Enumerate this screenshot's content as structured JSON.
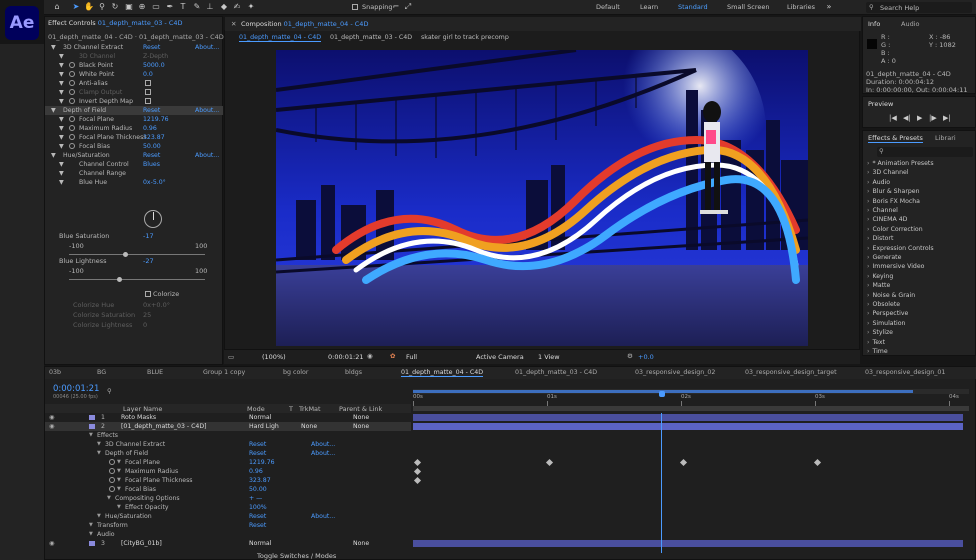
{
  "app": {
    "logo": "Ae"
  },
  "toolbar": {
    "snapping": "Snapping",
    "workspaces": [
      "Default",
      "Learn",
      "Standard",
      "Small Screen",
      "Libraries"
    ],
    "active_workspace": "Standard",
    "search": "Search Help"
  },
  "effect_controls": {
    "tab": "Effect Controls",
    "tab_layer": "01_depth_matte_03 - C4D",
    "breadcrumb": "01_depth_matte_04 - C4D · 01_depth_matte_03 - C4D",
    "rows": [
      {
        "label": "3D Channel Extract",
        "reset": "Reset",
        "about": "About..."
      },
      {
        "label": "3D Channel",
        "value": "Z-Depth",
        "dim": true
      },
      {
        "label": "Black Point",
        "value": "5000.0"
      },
      {
        "label": "White Point",
        "value": "0.0"
      },
      {
        "label": "Anti-alias",
        "check": true
      },
      {
        "label": "Clamp Output",
        "check": true,
        "dim": true
      },
      {
        "label": "Invert Depth Map",
        "check": true
      },
      {
        "label": "Depth of Field",
        "reset": "Reset",
        "about": "About..."
      },
      {
        "label": "Focal Plane",
        "value": "1219.76"
      },
      {
        "label": "Maximum Radius",
        "value": "0.96"
      },
      {
        "label": "Focal Plane Thickness",
        "value": "323.87"
      },
      {
        "label": "Focal Bias",
        "value": "50.00"
      },
      {
        "label": "Hue/Saturation",
        "reset": "Reset",
        "about": "About..."
      },
      {
        "label": "Channel Control",
        "value": "Blues"
      },
      {
        "label": "Channel Range"
      },
      {
        "label": "Blue Hue",
        "value": "0x-5.0°"
      }
    ],
    "blue_saturation": {
      "label": "Blue Saturation",
      "value": "-17",
      "min": "-100",
      "max": "100"
    },
    "blue_lightness": {
      "label": "Blue Lightness",
      "value": "-27",
      "min": "-100",
      "max": "100"
    },
    "colorize": "Colorize",
    "dim_rows": [
      {
        "label": "Colorize Hue",
        "value": "0x+0.0°"
      },
      {
        "label": "Colorize Saturation",
        "value": "25"
      },
      {
        "label": "Colorize Lightness",
        "value": "0"
      }
    ]
  },
  "composition": {
    "panel_tab": "Composition",
    "panel_comp": "01_depth_matte_04 - C4D",
    "tabs": [
      "01_depth_matte_04 - C4D",
      "01_depth_matte_03 - C4D",
      "skater girl to track precomp"
    ],
    "bottom": {
      "zoom": "(100%)",
      "time": "0:00:01:21",
      "res": "Full",
      "camera": "Active Camera",
      "views": "1 View",
      "exposure": "+0.0"
    }
  },
  "info": {
    "tabs": [
      "Info",
      "Audio"
    ],
    "rgb": [
      "R :",
      "G :",
      "B :",
      "A : 0"
    ],
    "xy": [
      "X : -86",
      "Y : 1082"
    ],
    "comp": "01_depth_matte_04 - C4D",
    "duration": "Duration: 0:00:04:12",
    "inout": "In: 0:00:00:00, Out: 0:00:04:11"
  },
  "preview": {
    "title": "Preview"
  },
  "effects_presets": {
    "tabs": [
      "Effects & Presets",
      "Librari"
    ],
    "items": [
      "* Animation Presets",
      "3D Channel",
      "Audio",
      "Blur & Sharpen",
      "Boris FX Mocha",
      "Channel",
      "CINEMA 4D",
      "Color Correction",
      "Distort",
      "Expression Controls",
      "Generate",
      "Immersive Video",
      "Keying",
      "Matte",
      "Noise & Grain",
      "Obsolete",
      "Perspective",
      "Simulation",
      "Stylize",
      "Text",
      "Time"
    ]
  },
  "timeline": {
    "tabs": [
      "03b",
      "BG",
      "BLUE",
      "Group 1 copy",
      "bg color",
      "bldgs",
      "01_depth_matte_04 - C4D",
      "01_depth_matte_03 - C4D",
      "03_responsive_design_02",
      "03_responsive_design_target",
      "03_responsive_design_01"
    ],
    "time": "0:00:01:21",
    "fps": "00046 (25.00 fps)",
    "cols": {
      "layer": "Layer Name",
      "mode": "Mode",
      "t": "T",
      "trkmat": "TrkMat",
      "parent": "Parent & Link"
    },
    "ruler": [
      "00s",
      "01s",
      "02s",
      "03s",
      "04s"
    ],
    "layers": [
      {
        "num": "1",
        "name": "Roto Masks",
        "mode": "Normal",
        "parent": "None"
      },
      {
        "num": "2",
        "name": "[01_depth_matte_03 - C4D]",
        "mode": "Hard Ligh",
        "trk": "None",
        "parent": "None"
      }
    ],
    "props": [
      {
        "label": "Effects"
      },
      {
        "label": "3D Channel Extract",
        "reset": "Reset",
        "about": "About..."
      },
      {
        "label": "Depth of Field",
        "reset": "Reset",
        "about": "About..."
      },
      {
        "label": "Focal Plane",
        "value": "1219.76"
      },
      {
        "label": "Maximum Radius",
        "value": "0.96"
      },
      {
        "label": "Focal Plane Thickness",
        "value": "323.87"
      },
      {
        "label": "Focal Bias",
        "value": "50.00"
      },
      {
        "label": "Compositing Options",
        "value": "+ —"
      },
      {
        "label": "Effect Opacity",
        "value": "100%"
      },
      {
        "label": "Hue/Saturation",
        "reset": "Reset",
        "about": "About..."
      },
      {
        "label": "Transform",
        "reset": "Reset"
      },
      {
        "label": "Audio"
      }
    ],
    "layer3": {
      "num": "3",
      "name": "[CityBG_01b]",
      "mode": "Normal",
      "parent": "None"
    },
    "toggle": "Toggle Switches / Modes"
  }
}
